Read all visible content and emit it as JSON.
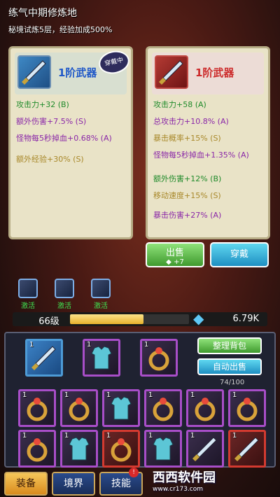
{
  "header": {
    "title": "练气中期修炼地",
    "subtitle": "秘境试炼5层，经验加成500%"
  },
  "left_card": {
    "name": "1阶武器",
    "badge": "穿戴中",
    "icon": "sword-icon",
    "stats": [
      "攻击力+32 (B)",
      "额外伤害+7.5% (S)",
      "怪物每5秒掉血+0.68% (A)",
      "额外经验+30% (S)"
    ]
  },
  "right_card": {
    "name": "1阶武器",
    "icon": "sword-icon",
    "stats": [
      "攻击力+58 (A)",
      "总攻击力+10.8% (A)",
      "暴击概率+15% (S)",
      "怪物每5秒掉血+1.35% (A)",
      "额外伤害+12% (B)",
      "移动速度+15% (S)",
      "暴击伤害+27% (A)"
    ]
  },
  "actions": {
    "sell": "出售",
    "sell_gain": "+7",
    "equip": "穿戴"
  },
  "skills": [
    {
      "label": "激活"
    },
    {
      "label": "激活"
    },
    {
      "label": "激活"
    }
  ],
  "status": {
    "level": "66级",
    "exp_fraction": 0.62,
    "gems": "6.79K"
  },
  "inventory": {
    "equipped": [
      {
        "num": "1",
        "type": "sword-icon",
        "rarity": "blue"
      },
      {
        "num": "1",
        "type": "armor-icon",
        "rarity": "purple"
      },
      {
        "num": "1",
        "type": "ring-icon",
        "rarity": "purple"
      }
    ],
    "sort_button": "整理背包",
    "auto_sell_button": "自动出售",
    "capacity": "74/100",
    "items": [
      {
        "num": "1",
        "type": "ring-icon",
        "rarity": "purple"
      },
      {
        "num": "1",
        "type": "ring-icon",
        "rarity": "purple"
      },
      {
        "num": "1",
        "type": "armor-icon",
        "rarity": "purple"
      },
      {
        "num": "1",
        "type": "ring-icon",
        "rarity": "purple"
      },
      {
        "num": "1",
        "type": "ring-icon",
        "rarity": "purple"
      },
      {
        "num": "1",
        "type": "ring-icon",
        "rarity": "purple"
      },
      {
        "num": "1",
        "type": "ring-icon",
        "rarity": "purple"
      },
      {
        "num": "1",
        "type": "armor-icon",
        "rarity": "purple"
      },
      {
        "num": "1",
        "type": "ring-icon",
        "rarity": "red"
      },
      {
        "num": "1",
        "type": "armor-icon",
        "rarity": "purple"
      },
      {
        "num": "1",
        "type": "sword-icon",
        "rarity": "purple"
      },
      {
        "num": "1",
        "type": "sword-icon",
        "rarity": "red"
      }
    ]
  },
  "nav": {
    "tab1": "装备",
    "tab2": "境界",
    "tab3": "技能",
    "notify": "!"
  },
  "watermark": {
    "text": "西西软件园",
    "url": "www.cr173.com"
  }
}
